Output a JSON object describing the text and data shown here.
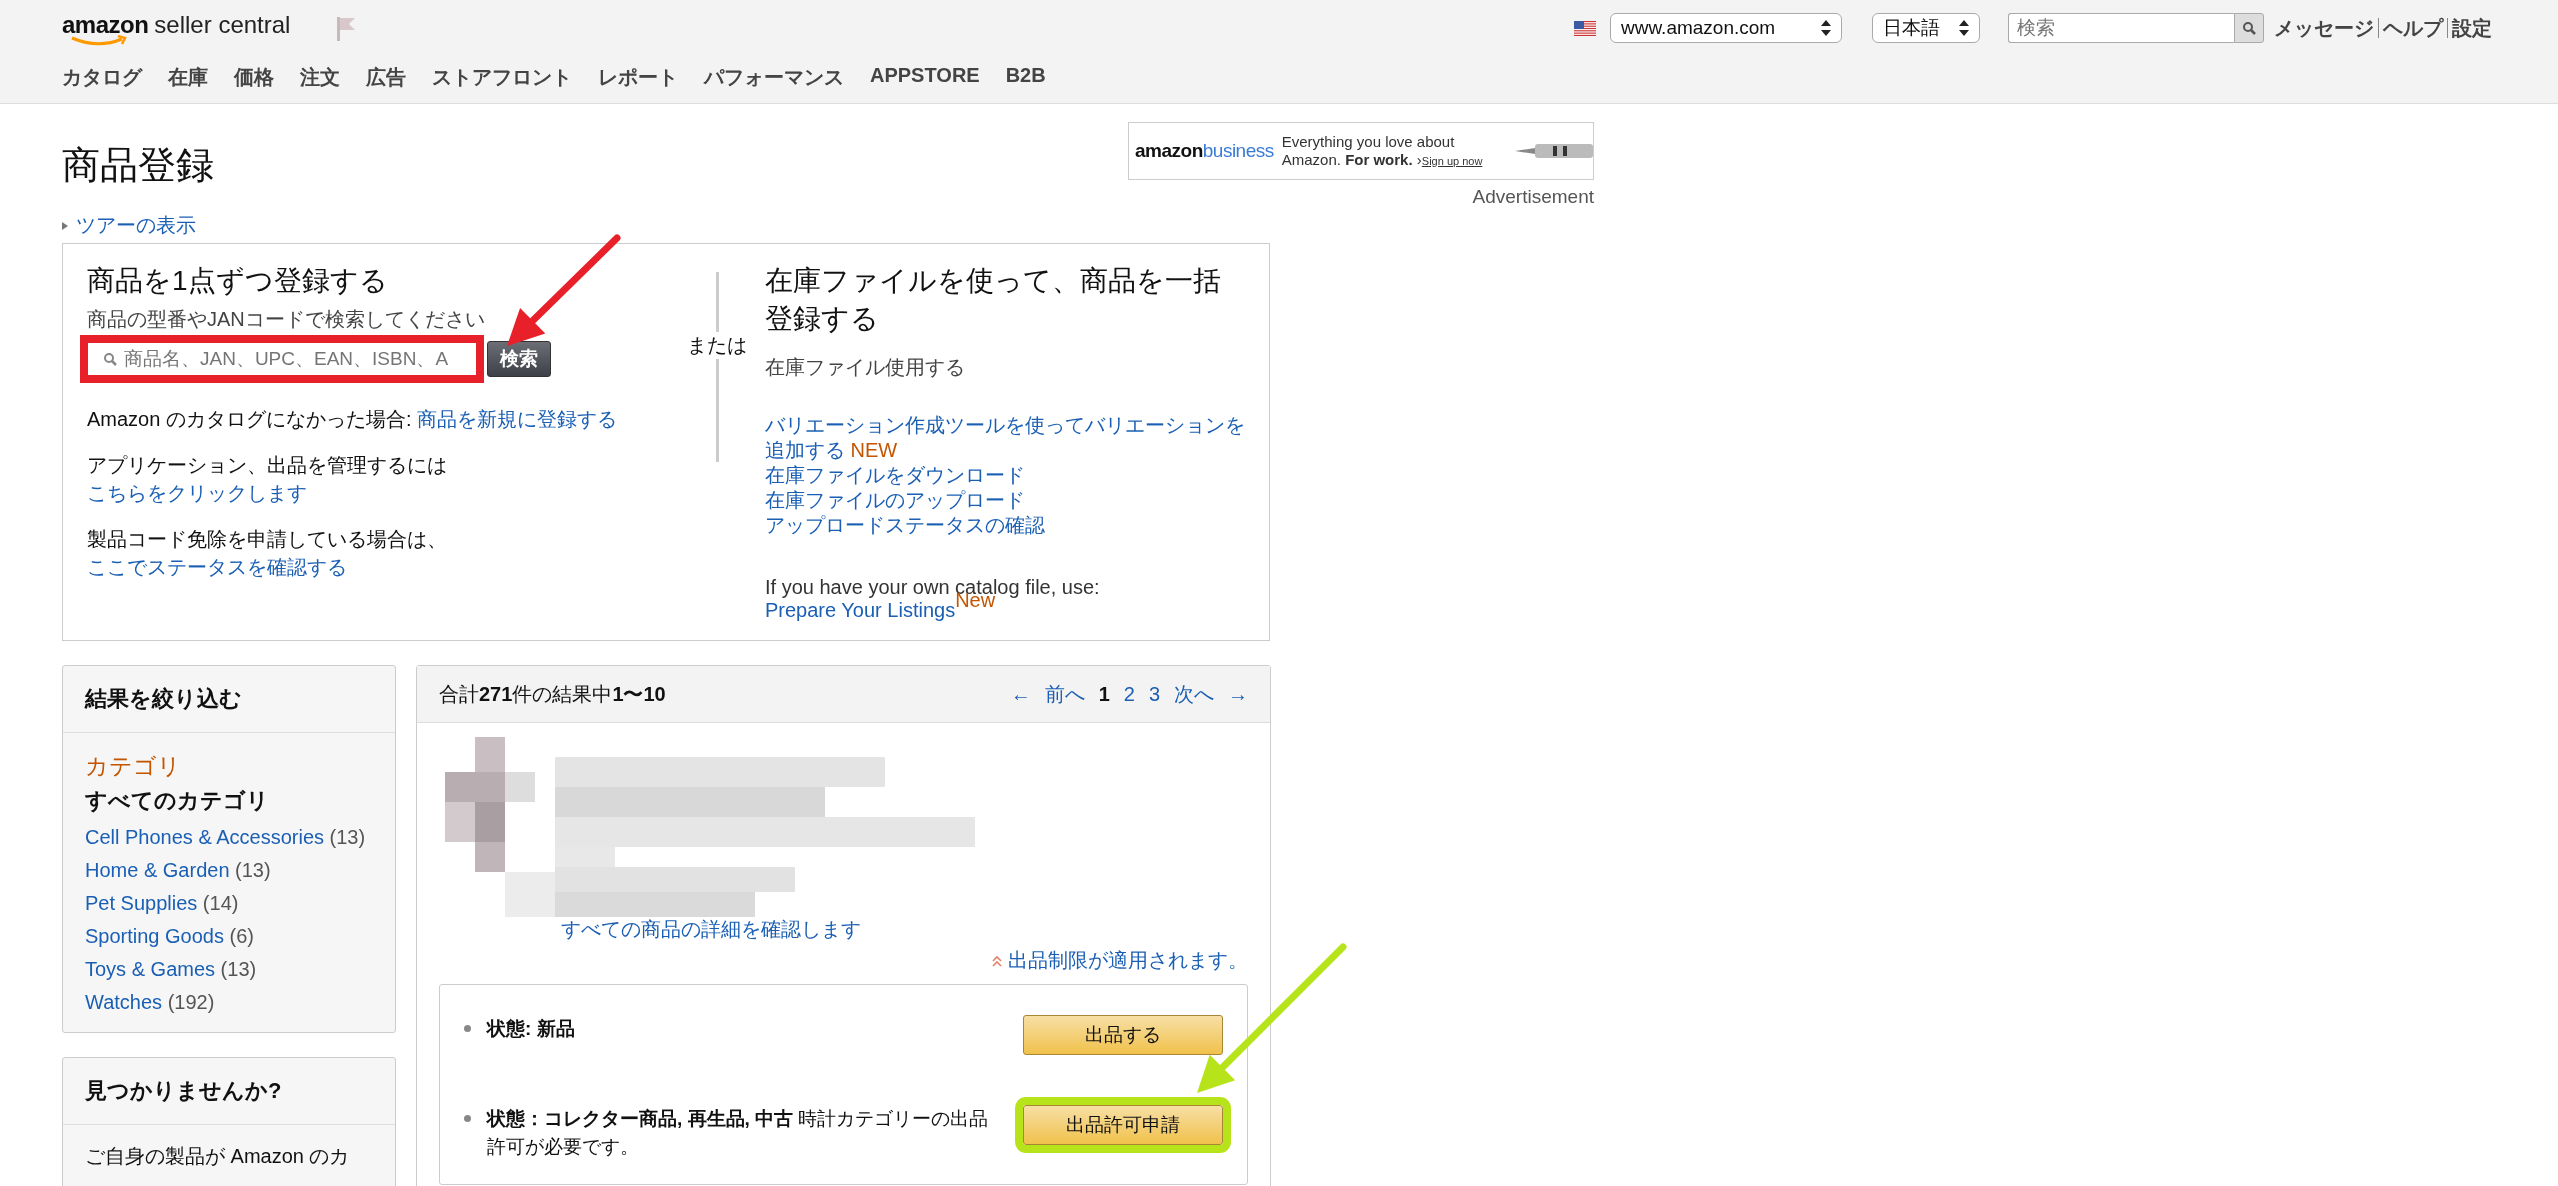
{
  "header": {
    "logo": {
      "brand": "amazon",
      "product": "seller central"
    },
    "marketplace_select": "www.amazon.com",
    "language_select": "日本語",
    "search": {
      "placeholder": "検索"
    },
    "links": [
      "メッセージ",
      "ヘルプ",
      "設定"
    ],
    "nav": [
      "カタログ",
      "在庫",
      "価格",
      "注文",
      "広告",
      "ストアフロント",
      "レポート",
      "パフォーマンス",
      "APPSTORE",
      "B2B"
    ]
  },
  "page_title": "商品登録",
  "ad": {
    "brand": "amazon",
    "brand_suffix": "business",
    "line_1": "Everything you love about",
    "line_2": "Amazon. **For work.**",
    "chevron": "›",
    "cta": "Sign up now",
    "caption": "Advertisement"
  },
  "tour_link": "ツアーの表示",
  "add_single": {
    "title": "商品を1点ずつ登録する",
    "hint": "商品の型番やJANコードで検索してください",
    "search": {
      "placeholder": "商品名、JAN、UPC、EAN、ISBN、A",
      "annotation": {
        "color": "#e8202a"
      }
    },
    "search_button": "検索",
    "notes": [
      {
        "text": "Amazon のカタログになかった場合: ",
        "link": "商品を新規に登録する"
      },
      {
        "text": "アプリケーション、出品を管理するには ",
        "link": "こちらをクリックします"
      },
      {
        "text": "製品コード免除を申請している場合は、 ",
        "link": "ここでステータスを確認する"
      }
    ]
  },
  "or_label": "または",
  "bulk": {
    "title": "在庫ファイルを使って、商品を一括登録する",
    "subtitle": "在庫ファイル使用する",
    "links": [
      {
        "text": "バリエーション作成ツールを使ってバリエーションを追加する",
        "badge": "NEW"
      },
      {
        "text": "在庫ファイルをダウンロード"
      },
      {
        "text": "在庫ファイルのアップロード"
      },
      {
        "text": "アップロードステータスの確認"
      }
    ],
    "catalog_note": "If you have your own catalog file, use:",
    "catalog_link": "Prepare Your Listings",
    "catalog_badge": "New"
  },
  "refine": {
    "title": "結果を絞り込む",
    "category_label": "カテゴリ",
    "all_label": "すべてのカテゴリ",
    "categories": [
      {
        "name": "Cell Phones & Accessories",
        "count": "(13)"
      },
      {
        "name": "Home & Garden",
        "count": "(13)"
      },
      {
        "name": "Pet Supplies",
        "count": "(14)"
      },
      {
        "name": "Sporting Goods",
        "count": "(6)"
      },
      {
        "name": "Toys & Games",
        "count": "(13)"
      },
      {
        "name": "Watches",
        "count": "(192)"
      }
    ]
  },
  "not_found": {
    "title": "見つかりませんか?",
    "text": "ご自身の製品が Amazon のカ"
  },
  "results": {
    "summary": "合計**271**件の結果中**1〜10**",
    "pagination": {
      "prev_arrow": "←",
      "prev": "前へ",
      "pages": [
        {
          "label": "1",
          "selected": true
        },
        {
          "label": "2",
          "selected": false
        },
        {
          "label": "3",
          "selected": false
        }
      ],
      "next": "次へ",
      "next_arrow": "→"
    },
    "details_link": "すべての商品の詳細を確認します",
    "restriction_note": "出品制限が適用されます。",
    "conditions": [
      {
        "label": "状態: 新品",
        "button": "出品する"
      },
      {
        "label": "状態：コレクター商品, 再生品, 中古",
        "note": "時計カテゴリーの出品許可が必要です。",
        "button": "出品許可申請",
        "annotation": {
          "color": "#b6e31a"
        }
      }
    ]
  }
}
